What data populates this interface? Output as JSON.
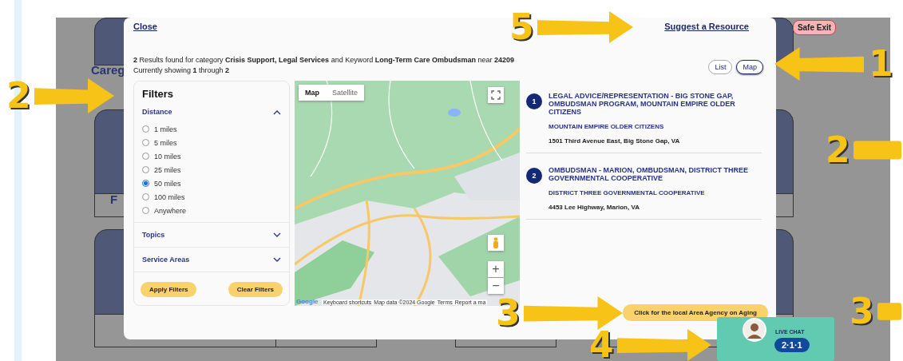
{
  "background_page": {
    "fragments": [
      "Careg",
      "F"
    ]
  },
  "safe_exit": "Safe Exit",
  "modal": {
    "close": "Close",
    "suggest": "Suggest a Resource",
    "summary": "**2** Results found for category **Crisis Support, Legal Services** and Keyword **Long-Term Care Ombudsman** near **24209**",
    "showing": "Currently showing **1** through **2**",
    "view_toggle": [
      {
        "label": "List",
        "selected": false
      },
      {
        "label": "Map",
        "selected": true
      }
    ],
    "filters": {
      "title": "Filters",
      "sections": [
        {
          "label": "Distance",
          "expanded": true,
          "options": [
            {
              "label": "1 miles",
              "selected": false
            },
            {
              "label": "5 miles",
              "selected": false
            },
            {
              "label": "10 miles",
              "selected": false
            },
            {
              "label": "25 miles",
              "selected": false
            },
            {
              "label": "50 miles",
              "selected": true
            },
            {
              "label": "100 miles",
              "selected": false
            },
            {
              "label": "Anywhere",
              "selected": false
            }
          ]
        },
        {
          "label": "Topics",
          "expanded": false
        },
        {
          "label": "Service Areas",
          "expanded": false
        }
      ],
      "buttons": [
        "Apply Filters",
        "Clear Filters"
      ]
    },
    "map": {
      "kind": "picture",
      "map_types": [
        {
          "label": "Map",
          "selected": true
        },
        {
          "label": "Satellite",
          "selected": false
        }
      ],
      "zoom_in": "+",
      "zoom_out": "−",
      "logo": "Google",
      "attribution": [
        "Keyboard shortcuts",
        "Map data ©2024 Google",
        "Terms",
        "Report a ma"
      ]
    },
    "results": [
      {
        "number": "1",
        "title": "LEGAL ADVICE/REPRESENTATION - BIG STONE GAP, OMBUDSMAN PROGRAM, MOUNTAIN EMPIRE OLDER CITIZENS",
        "organization": "MOUNTAIN EMPIRE OLDER CITIZENS",
        "address": "1501 Third Avenue East, Big Stone Gap, VA"
      },
      {
        "number": "2",
        "title": "OMBUDSMAN - MARION, OMBUDSMAN, DISTRICT THREE GOVERNMENTAL COOPERATIVE",
        "organization": "DISTRICT THREE GOVERNMENTAL COOPERATIVE",
        "address": "4453 Lee Highway, Marion, VA"
      }
    ],
    "aging_button": "Click for the local Area Agency on Aging"
  },
  "live_chat": {
    "label": "LIVE CHAT",
    "badge": "2·1·1"
  },
  "annotations": [
    {
      "number": "5"
    },
    {
      "number": "1"
    },
    {
      "number": "2"
    },
    {
      "number": "2"
    },
    {
      "number": "3"
    },
    {
      "number": "3"
    },
    {
      "number": "4"
    }
  ]
}
